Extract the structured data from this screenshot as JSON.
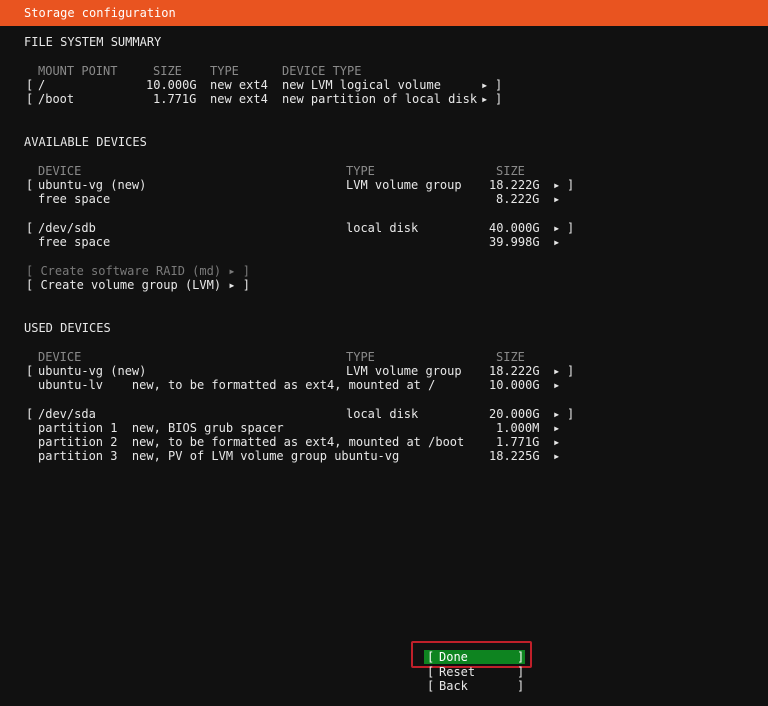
{
  "window": {
    "title": "Storage configuration"
  },
  "fs_summary": {
    "heading": "FILE SYSTEM SUMMARY",
    "columns": {
      "mount": "MOUNT POINT",
      "size": "SIZE",
      "type": "TYPE",
      "device_type": "DEVICE TYPE"
    },
    "rows": [
      {
        "mount": "/",
        "size": "10.000G",
        "type": "new ext4",
        "device_type": "new LVM logical volume"
      },
      {
        "mount": "/boot",
        "size": "1.771G",
        "type": "new ext4",
        "device_type": "new partition of local disk"
      }
    ]
  },
  "available": {
    "heading": "AVAILABLE DEVICES",
    "columns": {
      "device": "DEVICE",
      "type": "TYPE",
      "size": "SIZE"
    },
    "rows": [
      {
        "device": "ubuntu-vg (new)",
        "type": "LVM volume group",
        "size": "18.222G"
      },
      {
        "device": "free space",
        "type": "",
        "size": "8.222G"
      },
      {
        "device": "/dev/sdb",
        "type": "local disk",
        "size": "40.000G"
      },
      {
        "device": "free space",
        "type": "",
        "size": "39.998G"
      }
    ],
    "actions": [
      "[ Create software RAID (md) ▸ ]",
      "[ Create volume group (LVM) ▸ ]"
    ]
  },
  "used": {
    "heading": "USED DEVICES",
    "columns": {
      "device": "DEVICE",
      "type": "TYPE",
      "size": "SIZE"
    },
    "rows": [
      {
        "device": "ubuntu-vg (new)",
        "type": "LVM volume group",
        "size": "18.222G"
      },
      {
        "device": "ubuntu-lv    new, to be formatted as ext4, mounted at /",
        "type": "",
        "size": "10.000G"
      },
      {
        "device": "/dev/sda",
        "type": "local disk",
        "size": "20.000G"
      },
      {
        "device": "partition 1  new, BIOS grub spacer",
        "type": "",
        "size": "1.000M"
      },
      {
        "device": "partition 2  new, to be formatted as ext4, mounted at /boot",
        "type": "",
        "size": "1.771G"
      },
      {
        "device": "partition 3  new, PV of LVM volume group ubuntu-vg",
        "type": "",
        "size": "18.225G"
      }
    ]
  },
  "glyphs": {
    "open": "[",
    "close": "]",
    "arrow": "▸"
  },
  "buttons": {
    "done": "Done",
    "reset": "Reset",
    "back": "Back"
  }
}
